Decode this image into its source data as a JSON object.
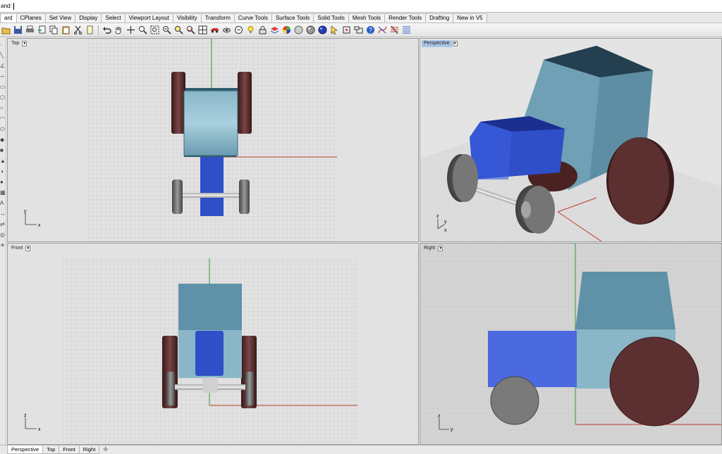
{
  "command": {
    "label": "and:"
  },
  "tabs": [
    {
      "label": "ard"
    },
    {
      "label": "CPlanes"
    },
    {
      "label": "Set View"
    },
    {
      "label": "Display"
    },
    {
      "label": "Select"
    },
    {
      "label": "Viewport Layout"
    },
    {
      "label": "Visibility"
    },
    {
      "label": "Transform"
    },
    {
      "label": "Curve Tools"
    },
    {
      "label": "Surface Tools"
    },
    {
      "label": "Solid Tools"
    },
    {
      "label": "Mesh Tools"
    },
    {
      "label": "Render Tools"
    },
    {
      "label": "Drafting"
    },
    {
      "label": "New in V5"
    }
  ],
  "toolbar_icons": [
    "open-icon",
    "save-icon",
    "print-icon",
    "import-icon",
    "copy-icon",
    "paste-icon",
    "cut-icon",
    "document-icon",
    "undo-icon",
    "pan-hand-icon",
    "move-icon",
    "zoom-icon",
    "zoom-window-icon",
    "zoom-extents-icon",
    "zoom-selected-icon",
    "rotate-view-icon",
    "layout-grid-icon",
    "car-icon",
    "camera-icon",
    "zoom-out-icon",
    "light-bulb-icon",
    "lock-icon",
    "layer-icon",
    "color-wheel-icon",
    "sphere-shaded-icon",
    "sphere-rendered-icon",
    "sphere-blue-icon",
    "cursor-icon",
    "grid-snap-icon",
    "properties-icon",
    "help-icon",
    "curve-tools-icon",
    "dimension-icon",
    "hatch-icon"
  ],
  "viewports": {
    "top": {
      "title": "Top",
      "axis_x": "x",
      "axis_y": "y"
    },
    "perspective": {
      "title": "Perspective",
      "axis_x": "x",
      "axis_y": "y",
      "axis_z": "z"
    },
    "front": {
      "title": "Front",
      "axis_x": "x",
      "axis_y": "z"
    },
    "right": {
      "title": "Right",
      "axis_x": "y",
      "axis_y": "z"
    }
  },
  "bottom_tabs": [
    {
      "label": "Perspective",
      "active": true
    },
    {
      "label": "Top"
    },
    {
      "label": "Front"
    },
    {
      "label": "Right"
    }
  ],
  "bottom_add": "✣",
  "colors": {
    "cab": "#5f91a8",
    "hood": "#2e4fc7",
    "wheel": "#5c3030",
    "front_wheel": "#6b6b6b",
    "axis_x": "#c0392b",
    "axis_y": "#2e9a3a",
    "viewport_bg": "#d4d4d4",
    "active_title": "#a9c4e4"
  }
}
